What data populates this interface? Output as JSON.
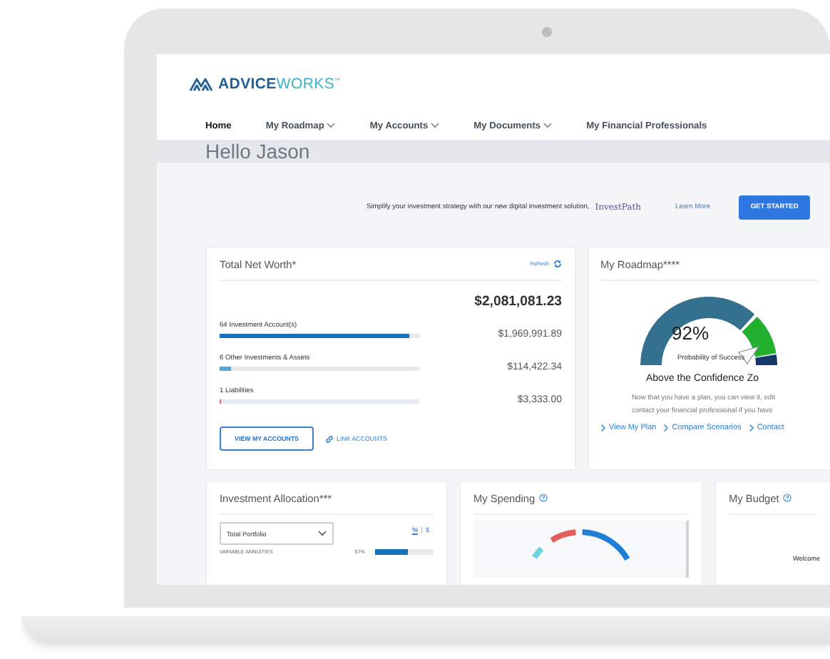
{
  "logo": {
    "brand": "ADVICE",
    "brand_suffix": "WORKS",
    "mark": "™"
  },
  "nav": [
    {
      "label": "Home",
      "selected": true,
      "has_menu": false
    },
    {
      "label": "My Roadmap",
      "selected": false,
      "has_menu": true
    },
    {
      "label": "My Accounts",
      "selected": false,
      "has_menu": true
    },
    {
      "label": "My Documents",
      "selected": false,
      "has_menu": true
    },
    {
      "label": "My Financial Professionals",
      "selected": false,
      "has_menu": false
    }
  ],
  "greeting": "Hello Jason",
  "promo": {
    "text": "Simplify your investment strategy with our new digital investment solution,",
    "product": "InvestPath",
    "link": "Learn More",
    "button": "GET STARTED"
  },
  "net_worth": {
    "title": "Total Net Worth*",
    "refresh": "Refresh",
    "total": "$2,081,081.23",
    "rows": [
      {
        "label": "64 Investment Account(s)",
        "level": 0.95,
        "amount": "$1,969,991.89",
        "color": "#1672b8"
      },
      {
        "label": "6 Other Investments & Assets",
        "level": 0.06,
        "amount": "$114,422.34",
        "color": "#5aa6d8"
      },
      {
        "label": "1 Liabilities",
        "level": 0.005,
        "amount": "$3,333.00",
        "color": "#e07070"
      }
    ],
    "primary_button": "VIEW MY ACCOUNTS",
    "link": "LINK ACCOUNTS"
  },
  "roadmap": {
    "title": "My Roadmap****",
    "percent": "92%",
    "caption": "Probability of Success",
    "zone": "Above the Confidence Zo",
    "message": [
      "Now that you have a plan, you can view it, edit",
      "contact your financial professional if you have"
    ],
    "links": [
      "View My Plan",
      "Compare Scenarios",
      "Contact"
    ]
  },
  "allocation": {
    "title": "Investment Allocation***",
    "select": "Total Portfolio",
    "toggle": [
      {
        "label": "%",
        "selected": true
      },
      {
        "label": "$",
        "selected": false
      }
    ],
    "separator": "|",
    "rows": [
      {
        "label": "VARIABLE ANNUITIES",
        "percent": "57%",
        "level": 0.57
      }
    ]
  },
  "spending": {
    "title": "My Spending"
  },
  "budget": {
    "title": "My Budget",
    "welcome": "Welcome"
  }
}
